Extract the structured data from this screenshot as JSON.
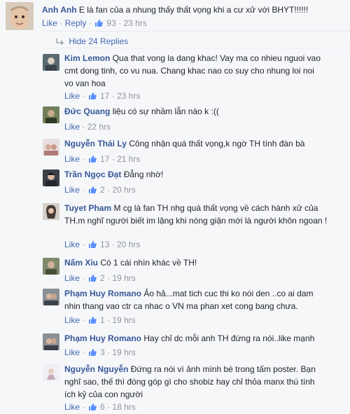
{
  "comment": {
    "author": "Anh Anh",
    "text": "E là fan của a nhung thấy thất vọng khi a cư xử với BHYT!!!!!!",
    "like": "Like",
    "reply": "Reply",
    "likes": "93",
    "time": "23 hrs",
    "dot": "·"
  },
  "toggle": {
    "label": "Hide 24 Replies"
  },
  "replies": [
    {
      "author": "Kim Lemon",
      "lines": [
        "Qua that vong la dang khac! Vay ma co nhieu nguoi vao",
        "cmt dong tinh, co vu nua. Chang khac nao co suy cho nhung loi noi",
        "vo van hoa"
      ],
      "likes": "17",
      "time": "23 hrs"
    },
    {
      "author": "Đức Quang",
      "lines": [
        "liệu có sự nhầm lẫn nào k :(("
      ],
      "likes": "",
      "time": "22 hrs"
    },
    {
      "author": "Nguyễn Thái Ly",
      "lines": [
        "Công nhận quá thất vọng,k ngờ TH tính đàn bà"
      ],
      "likes": "17",
      "time": "21 hrs"
    },
    {
      "author": "Trần Ngọc Đạt",
      "lines": [
        "Đẳng nhờ!"
      ],
      "likes": "2",
      "time": "20 hrs"
    },
    {
      "author": "Tuyet Pham",
      "lines": [
        "M cg là fan TH nhg quá thất vọng về cách hành xử của",
        "TH.m nghĩ người biết im lặng khi nóng giận mới là người khôn ngoan !"
      ],
      "likes": "13",
      "time": "20 hrs"
    },
    {
      "author": "Nấm Xiu",
      "lines": [
        "Có 1 cái nhìn khác về TH!"
      ],
      "likes": "2",
      "time": "19 hrs"
    },
    {
      "author": "Phạm Huy Romano",
      "lines": [
        "Ảo hả...mat tich cuc thi ko nói den ..co ai dam",
        "nhin thang vao ctr ca nhac o VN ma phan xet cong bang chưa."
      ],
      "likes": "1",
      "time": "19 hrs"
    },
    {
      "author": "Phạm Huy Romano",
      "lines": [
        "Hay chỉ dc mỗi anh TH đứng ra nói..like mạnh"
      ],
      "likes": "3",
      "time": "19 hrs"
    },
    {
      "author": "Nguyễn Nguyễn",
      "lines": [
        "Đứng ra nói vì ảnh mình bé trong tấm poster. Bạn",
        "nghĩ sao, thế thì đóng góp gì cho shobiz hay chỉ thỏa manx thú tính",
        "ích kỷ của con người"
      ],
      "likes": "6",
      "time": "18 hrs"
    }
  ],
  "colors": {
    "name": "#365899",
    "link": "#4267b2",
    "meta": "#90949c",
    "text": "#1d2129",
    "background": "#f6f7f9"
  },
  "icons": {
    "like_thumb": "thumbs-up-icon",
    "toggle": "reply-arrow-icon"
  }
}
